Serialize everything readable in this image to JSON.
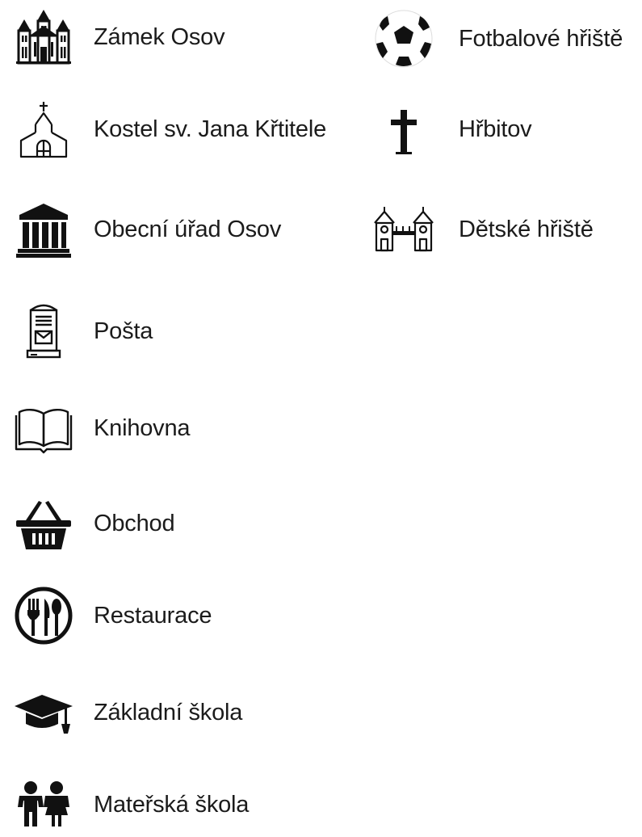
{
  "legend": {
    "left_column": [
      {
        "label": "Zámek Osov",
        "icon": "castle-icon"
      },
      {
        "label": "Kostel sv. Jana Křtitele",
        "icon": "church-icon"
      },
      {
        "label": "Obecní úřad Osov",
        "icon": "town-hall-icon"
      },
      {
        "label": "Pošta",
        "icon": "mailbox-icon"
      },
      {
        "label": "Knihovna",
        "icon": "book-icon"
      },
      {
        "label": "Obchod",
        "icon": "shopping-basket-icon"
      },
      {
        "label": "Restaurace",
        "icon": "restaurant-icon"
      },
      {
        "label": "Základní škola",
        "icon": "graduation-cap-icon"
      },
      {
        "label": "Mateřská škola",
        "icon": "children-icon"
      }
    ],
    "right_column": [
      {
        "label": "Fotbalové hřiště",
        "icon": "soccer-ball-icon"
      },
      {
        "label": "Hřbitov",
        "icon": "cross-icon"
      },
      {
        "label": "Dětské hřiště",
        "icon": "playground-icon"
      }
    ]
  },
  "colors": {
    "icon": "#111111",
    "text": "#1b1b1b",
    "background": "#ffffff"
  }
}
